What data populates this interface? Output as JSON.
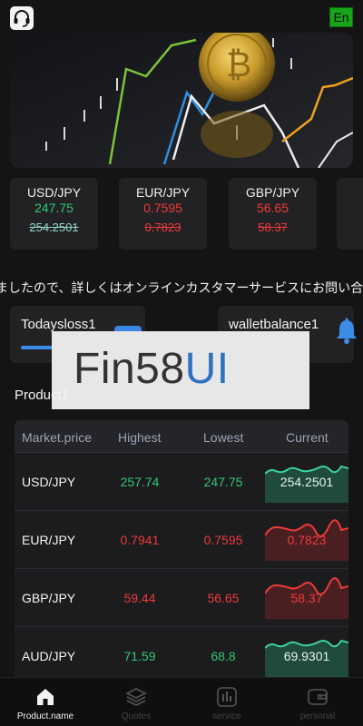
{
  "header": {
    "lang_label": "En"
  },
  "rates": [
    {
      "pair": "USD/JPY",
      "value": "247.75",
      "prev": "254.2501",
      "value_color": "green",
      "prev_color": "teal"
    },
    {
      "pair": "EUR/JPY",
      "value": "0.7595",
      "prev": "0.7823",
      "value_color": "red",
      "prev_color": "red"
    },
    {
      "pair": "GBP/JPY",
      "value": "56.65",
      "prev": "58.37",
      "value_color": "red",
      "prev_color": "red"
    }
  ],
  "notice": "ましたので、詳しくはオンラインカスタマーサービスにお問い合わ",
  "stats": {
    "left_label": "Todaysloss1",
    "left_progress_percent": 35,
    "right_label": "walletbalance1"
  },
  "watermark": {
    "text_main": "Fin58",
    "text_accent": "UI"
  },
  "section": {
    "title": "Product1"
  },
  "table": {
    "headers": [
      "Market.price",
      "Highest",
      "Lowest",
      "Current"
    ],
    "rows": [
      {
        "pair": "USD/JPY",
        "high": "257.74",
        "low": "247.75",
        "current": "254.2501",
        "trend": "up"
      },
      {
        "pair": "EUR/JPY",
        "high": "0.7941",
        "low": "0.7595",
        "current": "0.7823",
        "trend": "down"
      },
      {
        "pair": "GBP/JPY",
        "high": "59.44",
        "low": "56.65",
        "current": "58.37",
        "trend": "down"
      },
      {
        "pair": "AUD/JPY",
        "high": "71.59",
        "low": "68.8",
        "current": "69.9301",
        "trend": "up"
      }
    ]
  },
  "tabs": [
    "Product.name",
    "Quotes",
    "service",
    "personal"
  ],
  "colors": {
    "green": "#2fc872",
    "red": "#ee3a3a",
    "accent": "#3b8ce9"
  }
}
